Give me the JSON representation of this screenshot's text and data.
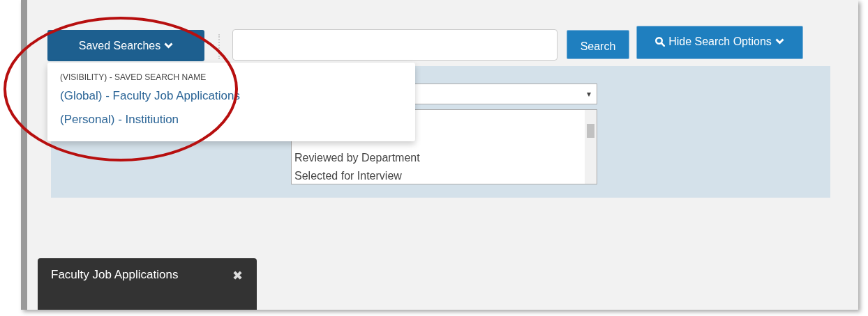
{
  "toolbar": {
    "saved_searches_button": {
      "label": "Saved Searches",
      "expanded": true
    },
    "search_button": "Search",
    "toggle_options_button": "Hide Search Options"
  },
  "saved_searches_menu": {
    "header": "(VISIBILITY) - SAVED SEARCH NAME",
    "items": [
      {
        "label": "(Global) - Faculty Job Applications"
      },
      {
        "label": "(Personal) - Institiution"
      }
    ]
  },
  "search_options": {
    "select": {
      "arrow": "▾"
    },
    "status_list": {
      "items": [
        {
          "label": "Reviewed by Department"
        },
        {
          "label": "Selected for Interview"
        }
      ]
    }
  },
  "saved_search_panel": {
    "title": "Faculty Job Applications",
    "close": "✖"
  }
}
